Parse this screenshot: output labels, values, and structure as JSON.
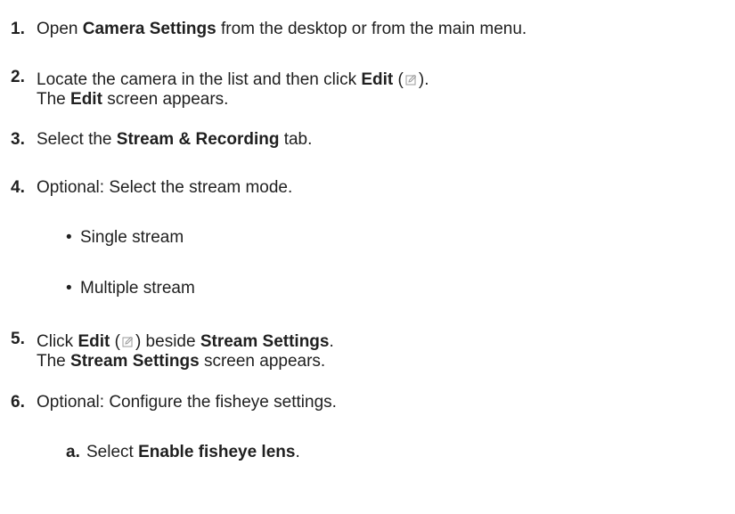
{
  "steps": [
    {
      "number": "1.",
      "segments": [
        {
          "t": "Open ",
          "b": false
        },
        {
          "t": "Camera Settings",
          "b": true
        },
        {
          "t": " from the desktop or from the main menu.",
          "b": false
        }
      ]
    },
    {
      "number": "2.",
      "line1_a": "Locate the camera in the list and then click ",
      "line1_bold": "Edit",
      "line1_b": " (",
      "line1_c": ").",
      "line2_a": "The ",
      "line2_bold": "Edit",
      "line2_b": " screen appears."
    },
    {
      "number": "3.",
      "segments": [
        {
          "t": "Select the ",
          "b": false
        },
        {
          "t": "Stream & Recording",
          "b": true
        },
        {
          "t": " tab.",
          "b": false
        }
      ]
    },
    {
      "number": "4.",
      "text": "Optional: Select the stream mode.",
      "bullets": [
        "Single stream",
        "Multiple stream"
      ],
      "bullet_char": "•"
    },
    {
      "number": "5.",
      "line1_a": "Click ",
      "line1_bold": "Edit",
      "line1_b": " (",
      "line1_c": ") beside ",
      "line1_bold2": "Stream Settings",
      "line1_d": ".",
      "line2_a": "The ",
      "line2_bold": "Stream Settings",
      "line2_b": " screen appears."
    },
    {
      "number": "6.",
      "text": "Optional: Configure the fisheye settings.",
      "sub_label": "a.",
      "sub_a": "Select ",
      "sub_bold": "Enable fisheye lens",
      "sub_b": "."
    }
  ],
  "icons": {
    "edit": "edit-icon"
  }
}
